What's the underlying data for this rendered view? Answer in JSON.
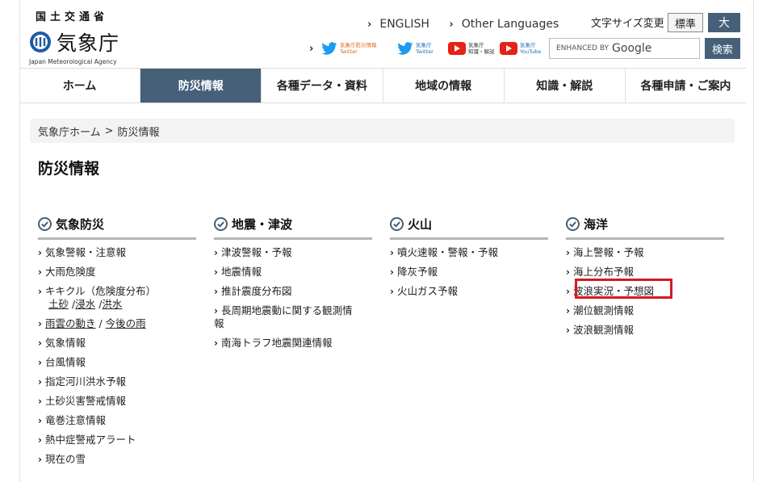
{
  "header": {
    "logo_kanji": "国土交通省",
    "logo_name": "気象庁",
    "logo_english": "Japan Meteorological Agency",
    "link_english": "ENGLISH",
    "link_other_languages": "Other Languages",
    "font_size_label": "文字サイズ変更",
    "font_standard": "標準",
    "font_large": "大",
    "social": [
      {
        "icon": "twitter-icon",
        "line1": "気象庁防災情報",
        "line2": "Twitter"
      },
      {
        "icon": "twitter-icon",
        "line1": "気象庁",
        "line2": "Twitter"
      },
      {
        "icon": "youtube-icon",
        "line1": "気象庁",
        "line2": "知識・解説"
      },
      {
        "icon": "youtube-icon",
        "line1": "気象庁",
        "line2": "YouTube"
      }
    ],
    "search_enhanced": "ENHANCED BY",
    "search_google": "Google",
    "search_button": "検索"
  },
  "nav": [
    "ホーム",
    "防災情報",
    "各種データ・資料",
    "地域の情報",
    "知識・解説",
    "各種申請・ご案内"
  ],
  "breadcrumb": {
    "home": "気象庁ホーム",
    "sep": ">",
    "current": "防災情報"
  },
  "page_title": "防災情報",
  "columns": {
    "weather": {
      "title": "気象防災",
      "items": [
        "気象警報・注意報",
        "大雨危険度",
        "キキクル（危険度分布）",
        "雨雲の動き",
        "今後の雨",
        "気象情報",
        "台風情報",
        "指定河川洪水予報",
        "土砂災害警戒情報",
        "竜巻注意情報",
        "熱中症警戒アラート",
        "現在の雪"
      ],
      "kikikuru_sub": [
        "土砂",
        "浸水",
        "洪水"
      ]
    },
    "quake": {
      "title": "地震・津波",
      "items": [
        "津波警報・予報",
        "地震情報",
        "推計震度分布図",
        "長周期地震動に関する観測情",
        "報",
        "南海トラフ地震関連情報"
      ]
    },
    "volcano": {
      "title": "火山",
      "items": [
        "噴火速報・警報・予報",
        "降灰予報",
        "火山ガス予報"
      ]
    },
    "ocean": {
      "title": "海洋",
      "items": [
        "海上警報・予報",
        "海上分布予報",
        "波浪実況・予想図",
        "潮位観測情報",
        "波浪観測情報"
      ]
    }
  },
  "colors": {
    "accent": "#46607a",
    "highlight": "#d71920"
  }
}
